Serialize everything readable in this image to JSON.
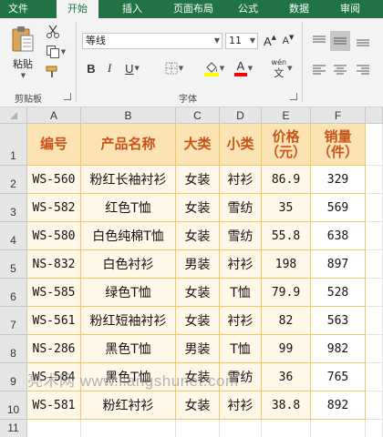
{
  "colors": {
    "accent": "#217346",
    "header_fill": "#fce3b4",
    "header_text": "#c8541a",
    "cell_light": "#fff8e8",
    "border": "#f2c769"
  },
  "tabs": [
    {
      "label": "文件",
      "active": false
    },
    {
      "label": "开始",
      "active": true
    },
    {
      "label": "插入",
      "active": false
    },
    {
      "label": "页面布局",
      "active": false
    },
    {
      "label": "公式",
      "active": false
    },
    {
      "label": "数据",
      "active": false
    },
    {
      "label": "审阅",
      "active": false
    }
  ],
  "ribbon": {
    "clipboard": {
      "paste_label": "粘贴",
      "group_label": "剪贴板",
      "icons": [
        "paste-icon",
        "cut-icon",
        "copy-icon",
        "format-painter-icon"
      ]
    },
    "font": {
      "group_label": "字体",
      "font_name": "等线",
      "font_size": "11",
      "bold": "B",
      "italic": "I",
      "underline": "U",
      "grow_font": "A",
      "shrink_font": "A",
      "font_color_letter": "A",
      "phonetic_top": "wén",
      "phonetic_bottom": "文",
      "icons": [
        "borders-icon",
        "fill-color-icon",
        "font-color-icon",
        "phonetic-icon"
      ]
    },
    "alignment": {
      "icons": [
        "align-top-icon",
        "align-middle-icon",
        "align-left-icon",
        "align-center-icon"
      ]
    }
  },
  "columns": [
    "A",
    "B",
    "C",
    "D",
    "E",
    "F"
  ],
  "rows": [
    "1",
    "2",
    "3",
    "4",
    "5",
    "6",
    "7",
    "8",
    "9",
    "10",
    "11"
  ],
  "table": {
    "headers": [
      [
        "编号"
      ],
      [
        "产品名称"
      ],
      [
        "大类"
      ],
      [
        "小类"
      ],
      [
        "价格",
        "（元）"
      ],
      [
        "销量",
        "（件）"
      ]
    ],
    "body": [
      [
        "WS-560",
        "粉红长袖衬衫",
        "女装",
        "衬衫",
        "86.9",
        "329"
      ],
      [
        "WS-582",
        "红色T恤",
        "女装",
        "雪纺",
        "35",
        "569"
      ],
      [
        "WS-580",
        "白色纯棉T恤",
        "女装",
        "雪纺",
        "55.8",
        "638"
      ],
      [
        "NS-832",
        "白色衬衫",
        "男装",
        "衬衫",
        "198",
        "897"
      ],
      [
        "WS-585",
        "绿色T恤",
        "女装",
        "T恤",
        "79.9",
        "528"
      ],
      [
        "WS-561",
        "粉红短袖衬衫",
        "女装",
        "衬衫",
        "82",
        "563"
      ],
      [
        "NS-286",
        "黑色T恤",
        "男装",
        "T恤",
        "99",
        "982"
      ],
      [
        "WS-584",
        "黑色T恤",
        "女装",
        "雪纺",
        "36",
        "765"
      ],
      [
        "WS-581",
        "粉红衬衫",
        "女装",
        "衬衫",
        "38.8",
        "892"
      ]
    ]
  },
  "watermark": "亮术网 www.liangshunet.com"
}
